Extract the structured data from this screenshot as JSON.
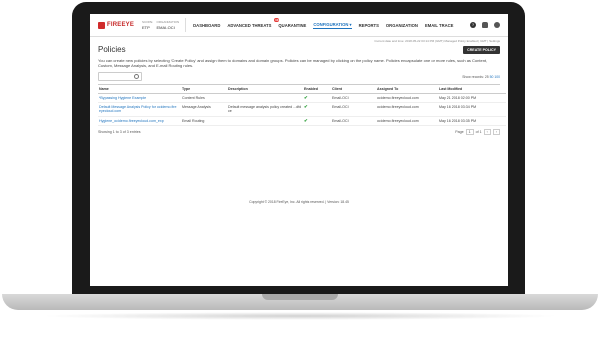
{
  "nav": {
    "logo": "FIREEYE",
    "scope_label": "SCOPE",
    "scope_value": "ETP",
    "org_label": "ORGANIZATION",
    "org_value": "EMAI-OCI",
    "items": [
      {
        "label": "DASHBOARD"
      },
      {
        "label": "ADVANCED THREATS",
        "badge": "10"
      },
      {
        "label": "QUARANTINE"
      },
      {
        "label": "CONFIGURATION ▾"
      },
      {
        "label": "REPORTS"
      },
      {
        "label": "ORGANIZATION"
      },
      {
        "label": "EMAIL TRACE"
      }
    ]
  },
  "subbar": "Current date and time: 2018-05-22 03:14 PM (GMT)   Managed Policy Enabled  |  GMT  |  Settings",
  "page": {
    "title": "Policies",
    "create_label": "CREATE POLICY",
    "description": "You can create new policies by selecting 'Create Policy' and assign them to domains and domain groups. Policies can be managed by clicking on the policy name. Policies encapsulate one or more rules, such as Content, Custom, Message Analysis, and E-mail Routing rules.",
    "search_placeholder": "",
    "show_records_label": "Show records: 25",
    "show_records_opts": [
      "50",
      "100"
    ]
  },
  "table": {
    "headers": [
      "Name",
      "Type",
      "Description",
      "Enabled",
      "Client",
      "Assigned To",
      "Last Modified"
    ],
    "rows": [
      {
        "name": "*Bypassing Hygiene Example",
        "type": "Content Rules",
        "description": "",
        "client": "Email-OCI",
        "assigned": "ocidemo.fireeyecloud.com",
        "modified": "May 21 2018 02:00 PM"
      },
      {
        "name": "Default Message Analysis Policy for ocidemo.fire eyecloud.com",
        "type": "Message Analysis",
        "description": "Default message analysis policy created ...dfd ce",
        "client": "Email-OCI",
        "assigned": "ocidemo.fireeyecloud.com",
        "modified": "May 16 2018 03:34 PM"
      },
      {
        "name": "Hygiene_ocidemo.fireeyecloud.com_exp",
        "type": "Email Routing",
        "description": "",
        "client": "Email-OCI",
        "assigned": "ocidemo.fireeyecloud.com",
        "modified": "May 16 2018 03:35 PM"
      }
    ]
  },
  "footer": {
    "showing": "Showing 1 to 3 of 3 entries",
    "page_label": "Page",
    "page_value": "1",
    "of_label": "of 1"
  },
  "copyright": "Copyright © 2018 FireEye, Inc. All rights reserved.  |  Version: 18.45"
}
